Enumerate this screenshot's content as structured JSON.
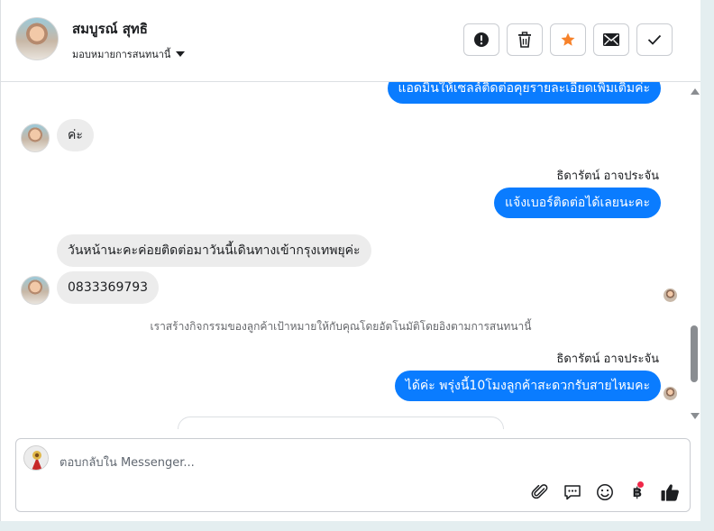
{
  "header": {
    "contact_name": "สมบูรณ์ สุทธิ",
    "assign_label": "มอบหมายการสนทนานี้",
    "actions": [
      {
        "name": "report-spam",
        "icon": "exclamation-icon"
      },
      {
        "name": "delete",
        "icon": "trash-icon"
      },
      {
        "name": "star",
        "icon": "star-icon"
      },
      {
        "name": "mark-unread",
        "icon": "envelope-icon"
      },
      {
        "name": "mark-done",
        "icon": "check-icon"
      }
    ]
  },
  "messages": [
    {
      "direction": "outgoing",
      "text": "แอดมินให้เซลล์ติดต่อคุยรายละเอียดเพิ่มเติมค่ะ"
    },
    {
      "direction": "incoming",
      "text": "ค่ะ"
    },
    {
      "direction": "outgoing",
      "sender": "ธิดารัตน์ อาจประจัน",
      "text": "แจ้งเบอร์ติดต่อได้เลยนะคะ"
    },
    {
      "direction": "incoming",
      "text": "วันหน้านะคะค่อยติดต่อมาวันนี้เดินทางเข้ากรุงเทพยุค่ะ"
    },
    {
      "direction": "incoming",
      "text": "0833369793"
    },
    {
      "direction": "system",
      "text": "เราสร้างกิจกรรมของลูกค้าเป้าหมายให้กับคุณโดยอัตโนมัติโดยอิงตามการสนทนานี้"
    },
    {
      "direction": "outgoing",
      "sender": "ธิดารัตน์ อาจประจัน",
      "text": "ได้ค่ะ พรุ่งนี้10โมงลูกค้าสะดวกรับสายไหมคะ"
    }
  ],
  "composer": {
    "placeholder": "ตอบกลับใน Messenger...",
    "tools": [
      "paperclip-icon",
      "saved-replies-icon",
      "emoji-icon",
      "baht-payment-icon",
      "thumbs-up-icon"
    ]
  },
  "colors": {
    "outgoing_bubble": "#0a7cff",
    "incoming_bubble": "#ececec",
    "star_accent": "#f7822a",
    "notification_dot": "#f02849"
  }
}
